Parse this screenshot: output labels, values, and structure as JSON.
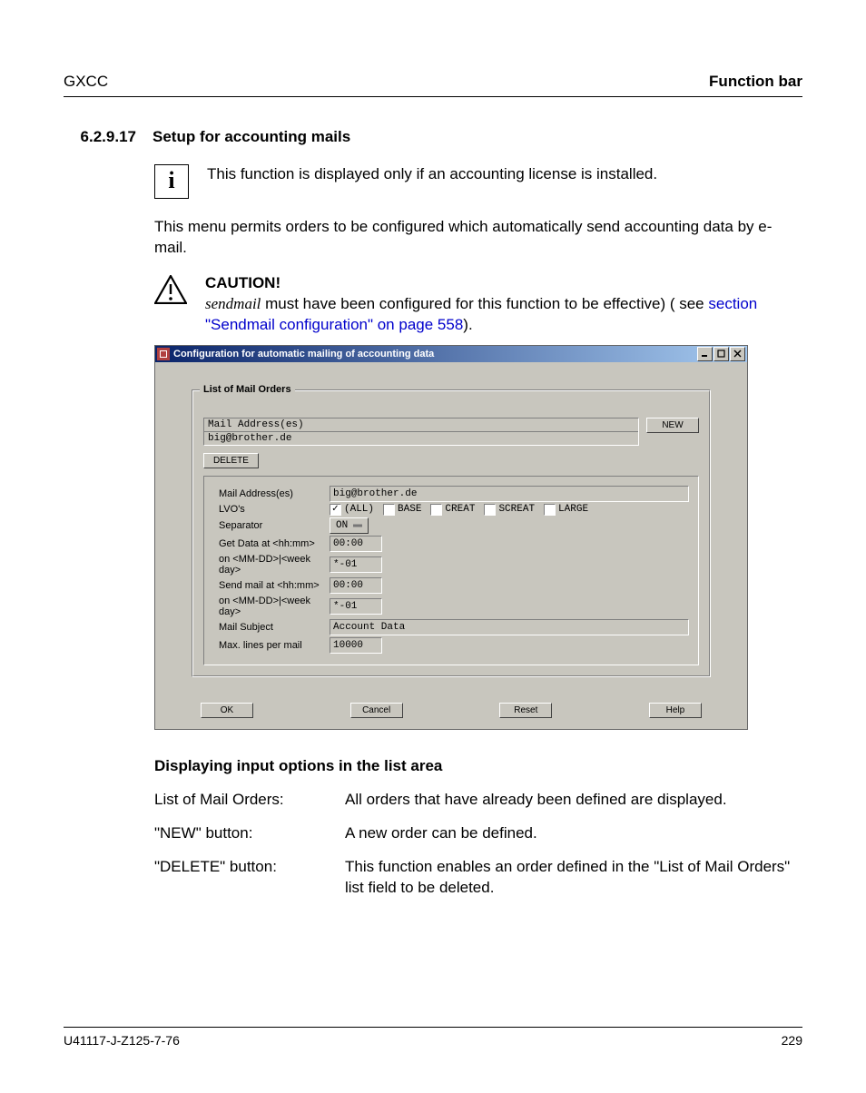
{
  "header": {
    "left": "GXCC",
    "right": "Function bar"
  },
  "section": {
    "num": "6.2.9.17",
    "title": "Setup for accounting mails"
  },
  "info_note": "This function is displayed only if an accounting license is installed.",
  "intro": "This menu permits orders to be configured which automatically send accounting data by e-mail.",
  "caution": {
    "title": "CAUTION!",
    "ital": "sendmail",
    "text_before": " must have been configured for this function to be effective) ( see ",
    "link": "section \"Sendmail configuration\" on page 558",
    "text_after": ")."
  },
  "window": {
    "title": "Configuration for automatic mailing of accounting data",
    "group_legend": "List of Mail Orders",
    "list_header": "Mail Address(es)",
    "list_item": "big@brother.de",
    "btn_new": "NEW",
    "btn_delete": "DELETE",
    "form": {
      "mail_addr_label": "Mail Address(es)",
      "mail_addr_value": "big@brother.de",
      "lvo_label": "LVO's",
      "lvo_opts": [
        {
          "label": "(ALL)",
          "checked": true
        },
        {
          "label": "BASE",
          "checked": false
        },
        {
          "label": "CREAT",
          "checked": false
        },
        {
          "label": "SCREAT",
          "checked": false
        },
        {
          "label": "LARGE",
          "checked": false
        }
      ],
      "separator_label": "Separator",
      "separator_value": "ON",
      "get_time_label": "Get Data at <hh:mm>",
      "get_time_value": "00:00",
      "get_day_label": "on <MM-DD>|<week day>",
      "get_day_value": "*-01",
      "send_time_label": "Send mail at <hh:mm>",
      "send_time_value": "00:00",
      "send_day_label": "on <MM-DD>|<week day>",
      "send_day_value": "*-01",
      "subject_label": "Mail Subject",
      "subject_value": "Account Data",
      "maxlines_label": "Max. lines per mail",
      "maxlines_value": "10000"
    },
    "btn_ok": "OK",
    "btn_cancel": "Cancel",
    "btn_reset": "Reset",
    "btn_help": "Help"
  },
  "subhead": "Displaying input options in the list area",
  "defs": {
    "listorders": {
      "term": "List of Mail Orders:",
      "def": "All orders that have already been defined are displayed."
    },
    "newbtn": {
      "term": "\"NEW\" button:",
      "def": "A new order can be defined."
    },
    "delbtn": {
      "term": "\"DELETE\" button:",
      "def": "This function enables an order defined in the \"List of Mail Orders\" list field to be deleted."
    }
  },
  "footer": {
    "left": "U41117-J-Z125-7-76",
    "right": "229"
  }
}
